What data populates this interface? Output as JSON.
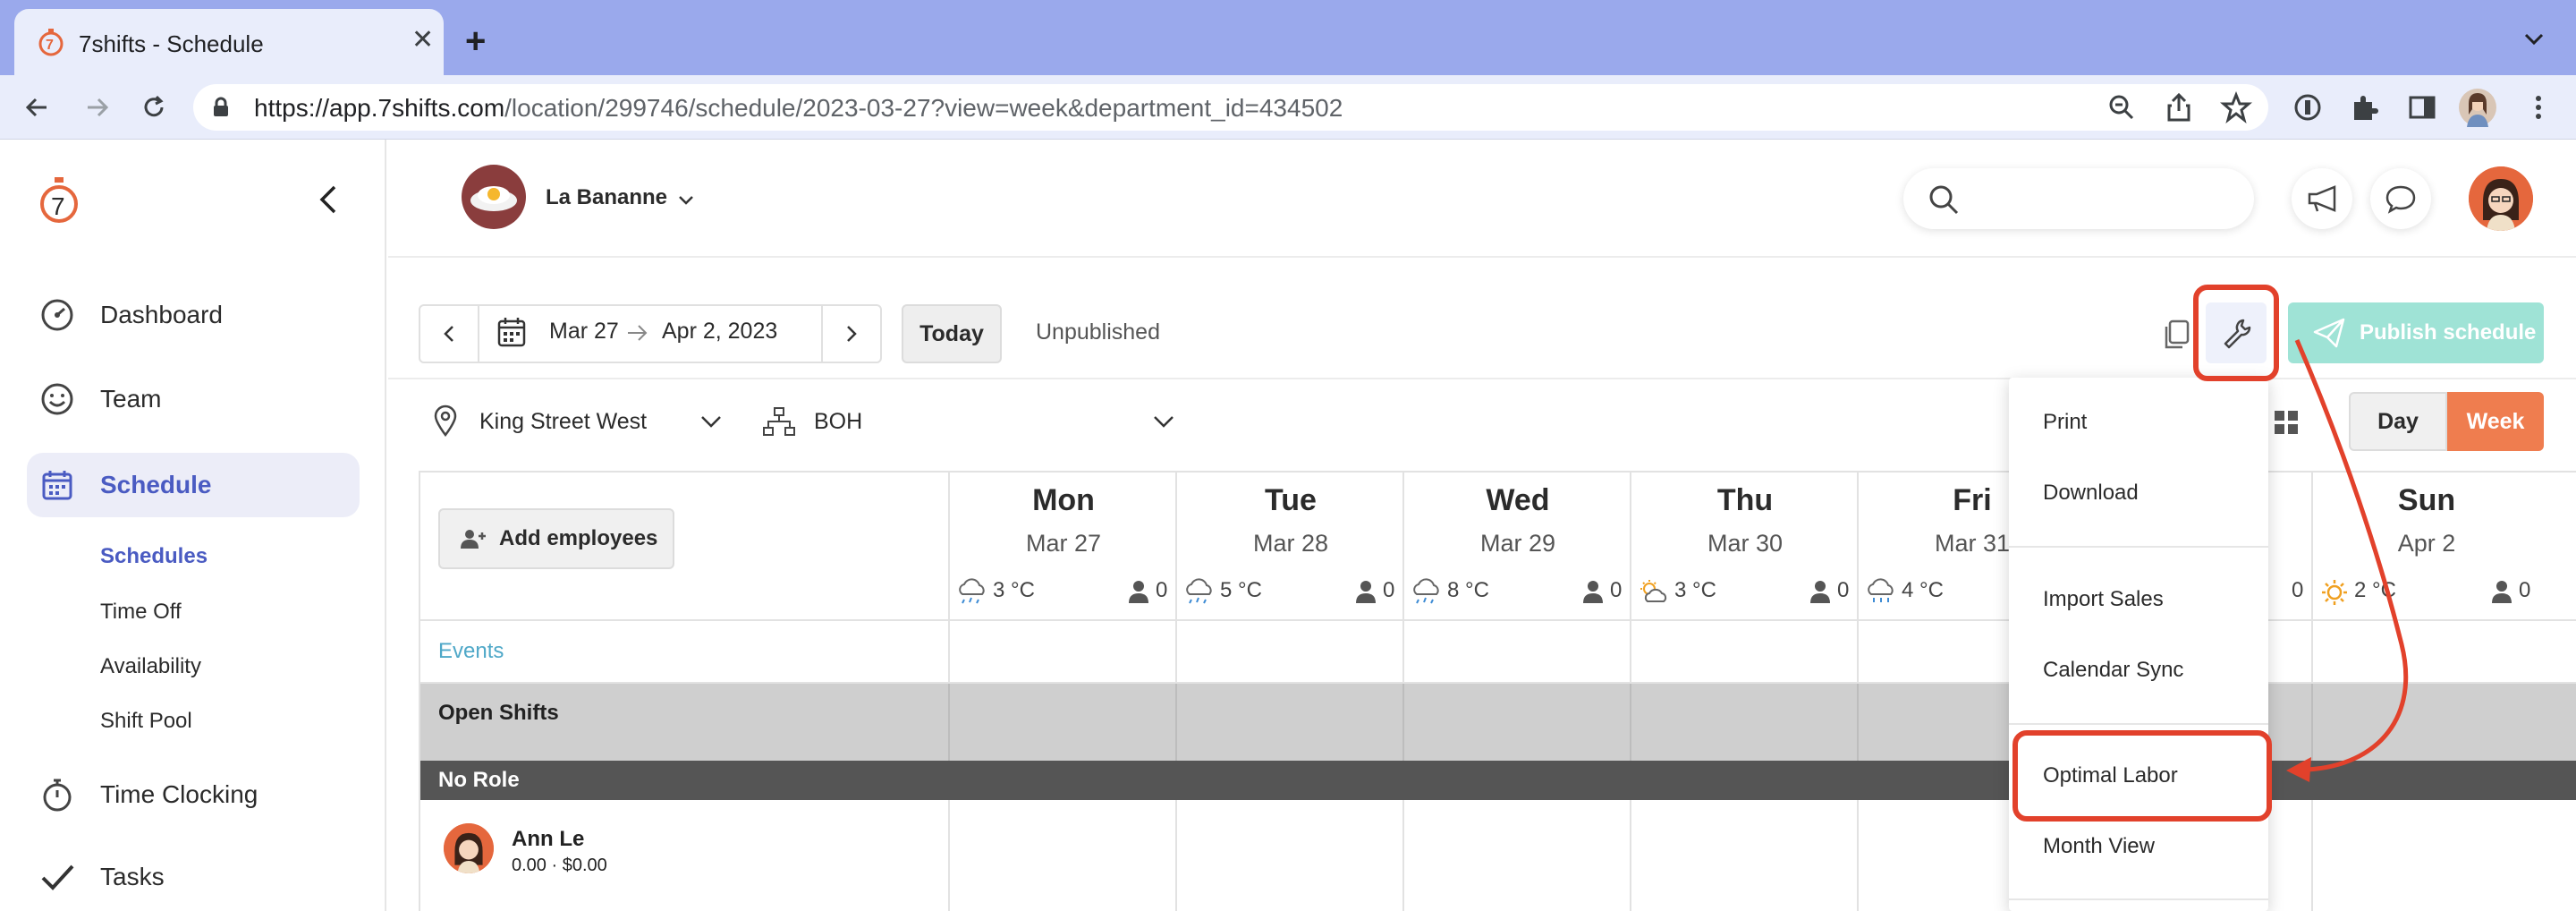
{
  "browser": {
    "tab_title": "7shifts - Schedule",
    "url_host": "https://app.7shifts.com",
    "url_path": "/location/299746/schedule/2023-03-27?view=week&department_id=434502"
  },
  "sidebar": {
    "items": [
      {
        "label": "Dashboard",
        "icon": "gauge-icon"
      },
      {
        "label": "Team",
        "icon": "smiley-icon"
      },
      {
        "label": "Schedule",
        "icon": "calendar-icon"
      },
      {
        "label": "Time Clocking",
        "icon": "stopwatch-icon"
      },
      {
        "label": "Tasks",
        "icon": "check-icon"
      }
    ],
    "sub_items": [
      "Schedules",
      "Time Off",
      "Availability",
      "Shift Pool"
    ]
  },
  "header": {
    "org_name": "La Bananne"
  },
  "toolbar": {
    "date_start": "Mar 27",
    "date_end": "Apr 2, 2023",
    "today_label": "Today",
    "status": "Unpublished",
    "publish_label": "Publish schedule"
  },
  "filters": {
    "location": "King Street West",
    "department": "BOH",
    "day_label": "Day",
    "week_label": "Week"
  },
  "schedule": {
    "add_employees_label": "Add employees",
    "events_label": "Events",
    "open_shifts_label": "Open Shifts",
    "no_role_label": "No Role",
    "days": [
      {
        "name": "Mon",
        "date": "Mar 27",
        "temp": "3 °C",
        "count": "0"
      },
      {
        "name": "Tue",
        "date": "Mar 28",
        "temp": "5 °C",
        "count": "0"
      },
      {
        "name": "Wed",
        "date": "Mar 29",
        "temp": "8 °C",
        "count": "0"
      },
      {
        "name": "Thu",
        "date": "Mar 30",
        "temp": "3 °C",
        "count": "0"
      },
      {
        "name": "Fri",
        "date": "Mar 31",
        "temp": "4 °C",
        "count": ""
      },
      {
        "name": "",
        "date": "",
        "temp": "",
        "count": "0"
      },
      {
        "name": "Sun",
        "date": "Apr 2",
        "temp": "2 °C",
        "count": "0"
      }
    ],
    "employee": {
      "name": "Ann Le",
      "stats": "0.00 · $0.00"
    }
  },
  "menu": {
    "items": [
      "Print",
      "Download",
      "Import Sales",
      "Calendar Sync",
      "Optimal Labor",
      "Month View"
    ]
  },
  "colors": {
    "accent": "#ef7d4f",
    "annotation": "#e2412b",
    "publish": "#9fe3d6",
    "brand_nav": "#4a5bc2"
  }
}
